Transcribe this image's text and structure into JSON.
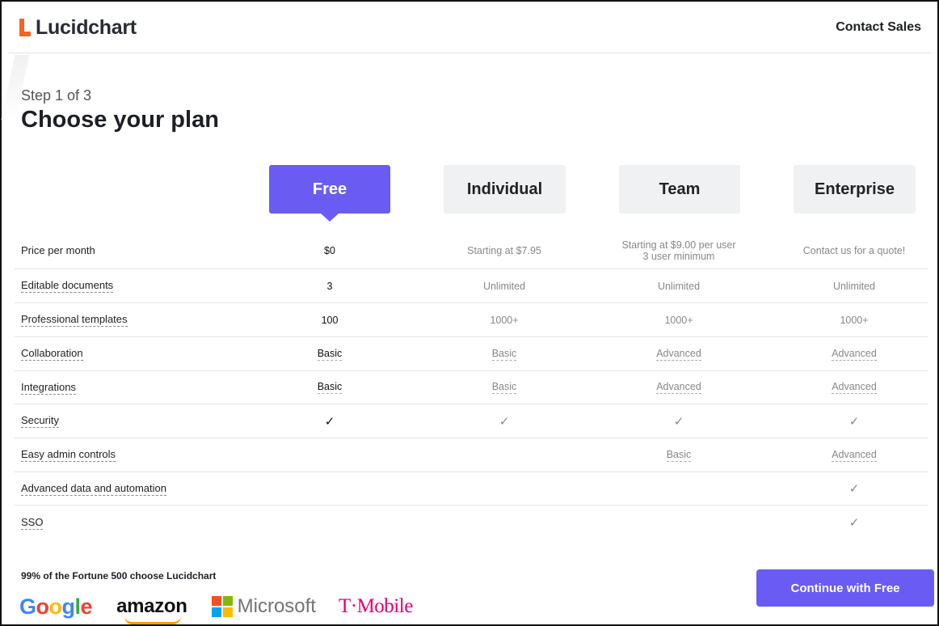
{
  "brand": {
    "name": "Lucidchart",
    "color": "#f26522"
  },
  "header": {
    "contact_label": "Contact Sales"
  },
  "step": {
    "label": "Step 1 of 3",
    "title": "Choose your plan"
  },
  "plans": [
    {
      "label": "Free",
      "selected": true
    },
    {
      "label": "Individual",
      "selected": false
    },
    {
      "label": "Team",
      "selected": false
    },
    {
      "label": "Enterprise",
      "selected": false
    }
  ],
  "features": [
    {
      "label": "Price per month",
      "dashed": false,
      "values": [
        "$0",
        "Starting at $7.95",
        "Starting at $9.00 per user",
        "Contact us for a quote!"
      ],
      "sub": [
        "",
        "",
        "3 user minimum",
        ""
      ]
    },
    {
      "label": "Editable documents",
      "dashed": true,
      "values": [
        "3",
        "Unlimited",
        "Unlimited",
        "Unlimited"
      ]
    },
    {
      "label": "Professional templates",
      "dashed": true,
      "values": [
        "100",
        "1000+",
        "1000+",
        "1000+"
      ]
    },
    {
      "label": "Collaboration",
      "dashed": true,
      "values": [
        "Basic",
        "Basic",
        "Advanced",
        "Advanced"
      ]
    },
    {
      "label": "Integrations",
      "dashed": true,
      "values": [
        "Basic",
        "Basic",
        "Advanced",
        "Advanced"
      ]
    },
    {
      "label": "Security",
      "dashed": true,
      "values": [
        "✓",
        "✓",
        "✓",
        "✓"
      ]
    },
    {
      "label": "Easy admin controls",
      "dashed": true,
      "values": [
        "",
        "",
        "Basic",
        "Advanced"
      ]
    },
    {
      "label": "Advanced data and automation",
      "dashed": true,
      "values": [
        "",
        "",
        "",
        "✓"
      ]
    },
    {
      "label": "SSO",
      "dashed": true,
      "values": [
        "",
        "",
        "",
        "✓"
      ]
    }
  ],
  "footer": {
    "fortune_text": "99% of the Fortune 500 choose Lucidchart",
    "logos": {
      "google": "Google",
      "amazon": "amazon",
      "microsoft": "Microsoft",
      "tmobile": "T·Mobile"
    },
    "continue_label": "Continue with Free"
  },
  "colors": {
    "accent": "#6a5cf3",
    "plan_bg": "#f0f1f3"
  }
}
